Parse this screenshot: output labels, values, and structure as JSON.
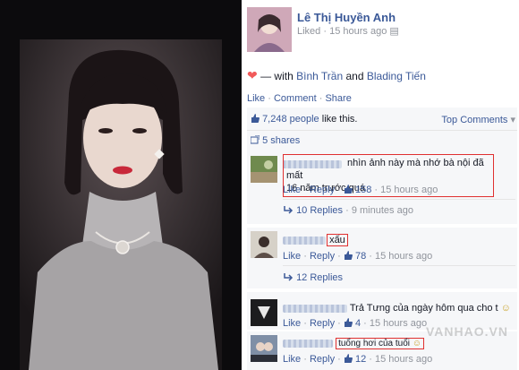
{
  "post": {
    "author": "Lê Thị Huyền Anh",
    "liked_label": "Liked",
    "time_ago": "15 hours ago",
    "with_label": "— with",
    "tag1": "Bình Trần",
    "and_label": "and",
    "tag2": "Blading Tiến",
    "action_like": "Like",
    "action_comment": "Comment",
    "action_share": "Share",
    "likes_count": "7,248 people",
    "likes_suffix": "like this.",
    "top_comments": "Top Comments",
    "shares": "5 shares"
  },
  "comments": [
    {
      "text1": "nhìn ảnh này mà nhớ bà nội đã mất",
      "text2": "16 năm trước quá",
      "like": "Like",
      "reply": "Reply",
      "count": "158",
      "time": "15 hours ago",
      "replies_label": "10 Replies",
      "replies_time": "9 minutes ago"
    },
    {
      "text1": "xấu",
      "like": "Like",
      "reply": "Reply",
      "count": "78",
      "time": "15 hours ago",
      "replies_label": "12 Replies"
    },
    {
      "text1": "Trả Tưng của ngày hôm qua cho t",
      "like": "Like",
      "reply": "Reply",
      "count": "4",
      "time": "15 hours ago"
    },
    {
      "text1": "tuổng hơi của tuổi",
      "like": "Like",
      "reply": "Reply",
      "count": "12",
      "time": "15 hours ago"
    }
  ],
  "watermark": "VANHAO.VN",
  "colors": {
    "fb_blue": "#3b5998",
    "heart": "#f15a5a",
    "highlight_box": "#e03030"
  }
}
